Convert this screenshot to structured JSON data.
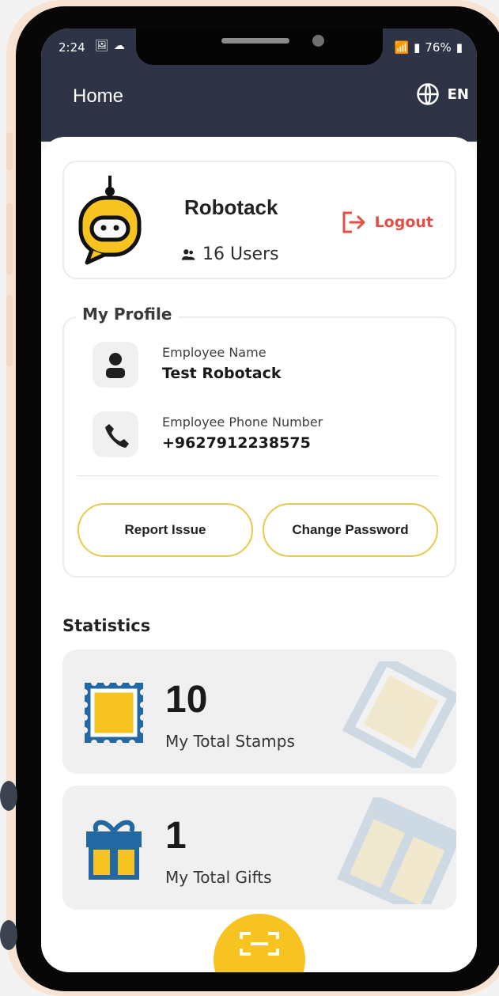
{
  "status_bar": {
    "time": "2:24",
    "battery": "76%"
  },
  "app_bar": {
    "title": "Home",
    "language": "EN"
  },
  "company": {
    "name": "Robotack",
    "users": "16 Users",
    "logout_label": "Logout"
  },
  "profile": {
    "title": "My Profile",
    "employee_name_label": "Employee Name",
    "employee_name": "Test Robotack",
    "phone_label": "Employee Phone Number",
    "phone": "+9627912238575",
    "report_issue_label": "Report Issue",
    "change_password_label": "Change Password"
  },
  "statistics": {
    "title": "Statistics",
    "stamps_value": "10",
    "stamps_label": "My Total Stamps",
    "gifts_value": "1",
    "gifts_label": "My Total Gifts"
  },
  "colors": {
    "header": "#2f3346",
    "accent_yellow": "#f6c321",
    "logout_red": "#e44f43",
    "icon_blue": "#2368a3"
  },
  "icons": {
    "language": "globe-icon",
    "logout": "logout-icon",
    "users": "users-icon",
    "person": "person-icon",
    "phone": "phone-icon",
    "stamp": "stamp-icon",
    "gift": "gift-icon",
    "scan": "scan-icon"
  }
}
